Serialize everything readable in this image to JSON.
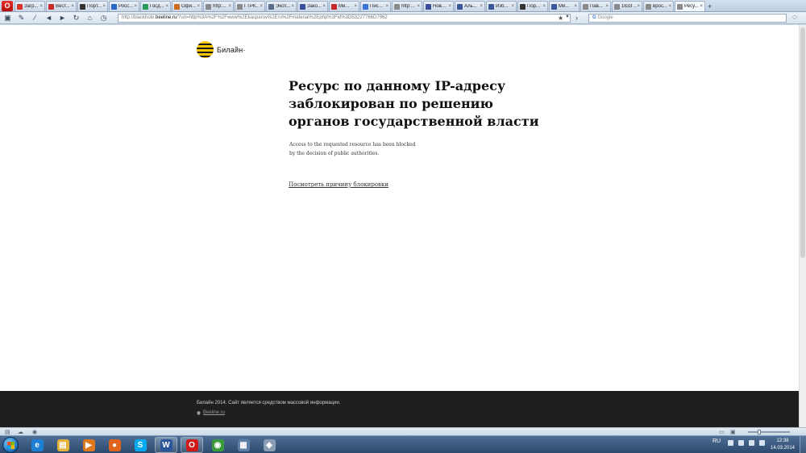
{
  "browser": {
    "menu_label": "O",
    "tabs": [
      {
        "title": "Загр...",
        "color": "#d9342b"
      },
      {
        "title": "Вест...",
        "color": "#c92b2b"
      },
      {
        "title": "Порт...",
        "color": "#333333"
      },
      {
        "title": "Росс...",
        "color": "#2a66c4"
      },
      {
        "title": "Госд...",
        "color": "#2a9a5a"
      },
      {
        "title": "Офи...",
        "color": "#cc6b1a"
      },
      {
        "title": "http:...",
        "color": "#8a8a8a"
      },
      {
        "title": "ГТРК...",
        "color": "#8a8a8a"
      },
      {
        "title": "Эксп...",
        "color": "#5a6e8a"
      },
      {
        "title": "Зако...",
        "color": "#3a4e9a"
      },
      {
        "title": "Ми...",
        "color": "#c82a2a"
      },
      {
        "title": "Пис...",
        "color": "#3b73d6"
      },
      {
        "title": "http:...",
        "color": "#8a8a8a"
      },
      {
        "title": "Нов...",
        "color": "#3a4e9a"
      },
      {
        "title": "Аль...",
        "color": "#3b5998"
      },
      {
        "title": "Изб...",
        "color": "#3b5998"
      },
      {
        "title": "Пор...",
        "color": "#333333"
      },
      {
        "title": "Ми...",
        "color": "#3b5998"
      },
      {
        "title": "Пав...",
        "color": "#8a8a8a"
      },
      {
        "title": "1633 ...",
        "color": "#8a8a8a"
      },
      {
        "title": "врос...",
        "color": "#8a8a8a"
      },
      {
        "title": "Ресу...",
        "color": "#8a8a8a",
        "active": true
      }
    ],
    "new_tab_label": "+",
    "url_prefix": "http://blackhole.",
    "url_host": "beeline.ru",
    "url_rest": "/?url=http%3A%2F%2Fwww%2Ekasparov%2Eru%2Fmaterial%2Ephp%3Fid%3D53227766D7962",
    "search_engine": "G",
    "search_placeholder": "Google",
    "toolbar_icons": [
      "panel-icon",
      "wrench-icon",
      "brush-icon",
      "back-icon",
      "forward-icon",
      "reload-icon",
      "home-icon",
      "speed-icon"
    ]
  },
  "page": {
    "logo_text": "Билайн·",
    "headline": [
      "Ресурс по данному IP-адресу",
      "заблокирован по решению",
      "органов государственной власти"
    ],
    "english_lines": [
      "Access to the requested resource has been blocked",
      "by the decision of public authorities."
    ],
    "reason_link": "Посмотреть причину блокировки",
    "footer_copy": "Билайн 2014. Сайт является средством массовой информации.",
    "footer_link": "Beeline.ru"
  },
  "colors": {
    "brand_yellow": "#fdc600",
    "footer_bg": "#1f1f1f"
  },
  "taskbar": {
    "apps": [
      {
        "name": "ie",
        "glyph": "e",
        "color": "#1e7fd6",
        "running": false
      },
      {
        "name": "explorer",
        "glyph": "▤",
        "color": "#e2b23a",
        "running": false
      },
      {
        "name": "media-player",
        "glyph": "▶",
        "color": "#e0791e",
        "running": false
      },
      {
        "name": "firefox",
        "glyph": "●",
        "color": "#e0641b",
        "running": false
      },
      {
        "name": "skype",
        "glyph": "S",
        "color": "#00a9f0",
        "running": false
      },
      {
        "name": "word",
        "glyph": "W",
        "color": "#2b579a",
        "running": true
      },
      {
        "name": "opera",
        "glyph": "O",
        "color": "#d21919",
        "running": true
      },
      {
        "name": "chrome",
        "glyph": "◉",
        "color": "#3a9c3a",
        "running": false
      },
      {
        "name": "window-switcher",
        "glyph": "▦",
        "color": "#5d7ea6",
        "running": false
      },
      {
        "name": "tool",
        "glyph": "◈",
        "color": "#8a9db5",
        "running": false
      }
    ],
    "language": "RU",
    "time": "12:38",
    "date": "14.03.2014"
  }
}
